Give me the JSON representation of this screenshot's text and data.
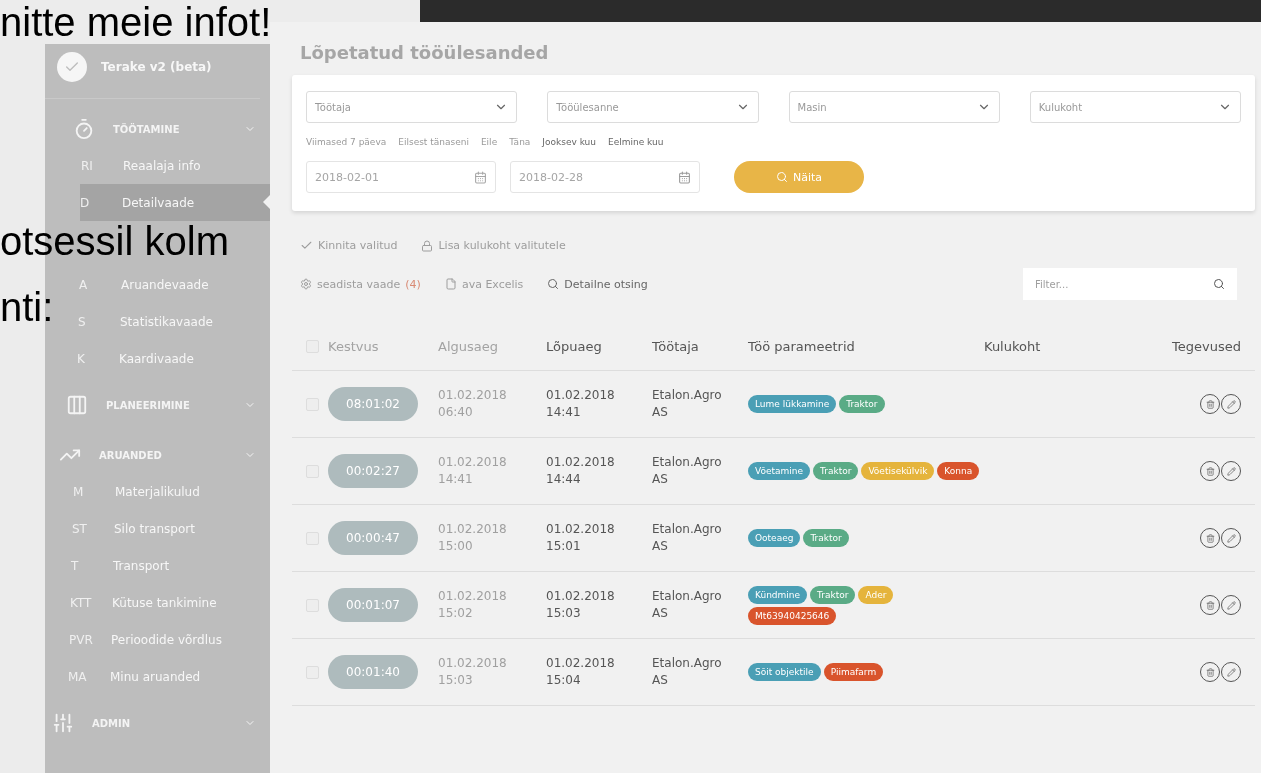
{
  "slide": {
    "heading": "nitte meie infot!",
    "body": [
      "otsessil kolm",
      "nti:"
    ]
  },
  "sidebar": {
    "app_name": "Terake v2 (beta)",
    "sections": [
      {
        "kind": "timer",
        "title": "TÖÖTAMINE",
        "items": [
          {
            "abbr": "RI",
            "label": "Reaalaja info",
            "selected": false
          },
          {
            "abbr": "D",
            "label": "Detailvaade",
            "selected": true
          },
          {
            "abbr": "A",
            "label": "Aruandevaade",
            "selected": false
          },
          {
            "abbr": "S",
            "label": "Statistikavaade",
            "selected": false
          },
          {
            "abbr": "K",
            "label": "Kaardivaade",
            "selected": false
          }
        ]
      },
      {
        "kind": "planning",
        "title": "PLANEERIMINE"
      },
      {
        "kind": "reports",
        "title": "ARUANDED",
        "items": [
          {
            "abbr": "M",
            "label": "Materjalikulud",
            "selected": false
          },
          {
            "abbr": "ST",
            "label": "Silo transport",
            "selected": false
          },
          {
            "abbr": "T",
            "label": "Transport",
            "selected": false
          },
          {
            "abbr": "KTT",
            "label": "Kütuse tankimine",
            "selected": false
          },
          {
            "abbr": "PVR",
            "label": "Perioodide võrdlus",
            "selected": false
          },
          {
            "abbr": "MA",
            "label": "Minu aruanded",
            "selected": false
          }
        ]
      },
      {
        "kind": "admin",
        "title": "ADMIN"
      }
    ]
  },
  "main": {
    "title": "Lõpetatud tööülesanded",
    "filters": [
      {
        "placeholder": "Töötaja"
      },
      {
        "placeholder": "Tööülesanne"
      },
      {
        "placeholder": "Masin"
      },
      {
        "placeholder": "Kulukoht"
      }
    ],
    "quick_ranges": [
      "Viimased 7 päeva",
      "Eilsest tänaseni",
      "Eile",
      "Täna",
      "Jooksev kuu",
      "Eelmine kuu"
    ],
    "date_from": "2018-02-01",
    "date_to": "2018-02-28",
    "show_button": "Näita",
    "bulk_actions": [
      {
        "kind": "check",
        "label": "Kinnita valitud"
      },
      {
        "kind": "lock",
        "label": "Lisa kulukoht valitutele"
      }
    ],
    "view_actions": [
      {
        "kind": "settings",
        "label": "seadista vaade",
        "count": "(4)"
      },
      {
        "kind": "file",
        "label": "ava Excelis"
      },
      {
        "kind": "search",
        "label": "Detailne otsing"
      }
    ],
    "filter_placeholder": "Filter...",
    "table": {
      "select_all_checked": false,
      "columns": [
        "Kestvus",
        "Algusaeg",
        "Lõpuaeg",
        "Töötaja",
        "Töö parameetrid",
        "Kulukoht",
        "Tegevused"
      ],
      "rows": [
        {
          "checked": false,
          "duration": "08:01:02",
          "start_date": "01.02.2018",
          "start_time": "06:40",
          "end_date": "01.02.2018",
          "end_time": "14:41",
          "worker": "Etalon.Agro AS",
          "tags": [
            {
              "label": "Lume lükkamine",
              "color": "#4a9fb5"
            },
            {
              "label": "Traktor",
              "color": "#5aab86"
            }
          ]
        },
        {
          "checked": false,
          "duration": "00:02:27",
          "start_date": "01.02.2018",
          "start_time": "14:41",
          "end_date": "01.02.2018",
          "end_time": "14:44",
          "worker": "Etalon.Agro AS",
          "tags": [
            {
              "label": "Võetamine",
              "color": "#4a9fb5"
            },
            {
              "label": "Traktor",
              "color": "#5aab86"
            },
            {
              "label": "Võetisekülvik",
              "color": "#e5b43c"
            },
            {
              "label": "Konna",
              "color": "#d9542c"
            }
          ]
        },
        {
          "checked": false,
          "duration": "00:00:47",
          "start_date": "01.02.2018",
          "start_time": "15:00",
          "end_date": "01.02.2018",
          "end_time": "15:01",
          "worker": "Etalon.Agro AS",
          "tags": [
            {
              "label": "Ooteaeg",
              "color": "#4a9fb5"
            },
            {
              "label": "Traktor",
              "color": "#5aab86"
            }
          ]
        },
        {
          "checked": false,
          "duration": "00:01:07",
          "start_date": "01.02.2018",
          "start_time": "15:02",
          "end_date": "01.02.2018",
          "end_time": "15:03",
          "worker": "Etalon.Agro AS",
          "tags": [
            {
              "label": "Kündmine",
              "color": "#4a9fb5"
            },
            {
              "label": "Traktor",
              "color": "#5aab86"
            },
            {
              "label": "Ader",
              "color": "#e5b43c"
            },
            {
              "label": "Mt63940425646",
              "color": "#d9542c"
            }
          ]
        },
        {
          "checked": false,
          "duration": "00:01:40",
          "start_date": "01.02.2018",
          "start_time": "15:03",
          "end_date": "01.02.2018",
          "end_time": "15:04",
          "worker": "Etalon.Agro AS",
          "tags": [
            {
              "label": "Sõit objektile",
              "color": "#4a9fb5"
            },
            {
              "label": "Piimafarm",
              "color": "#d9542c"
            }
          ]
        }
      ]
    }
  }
}
